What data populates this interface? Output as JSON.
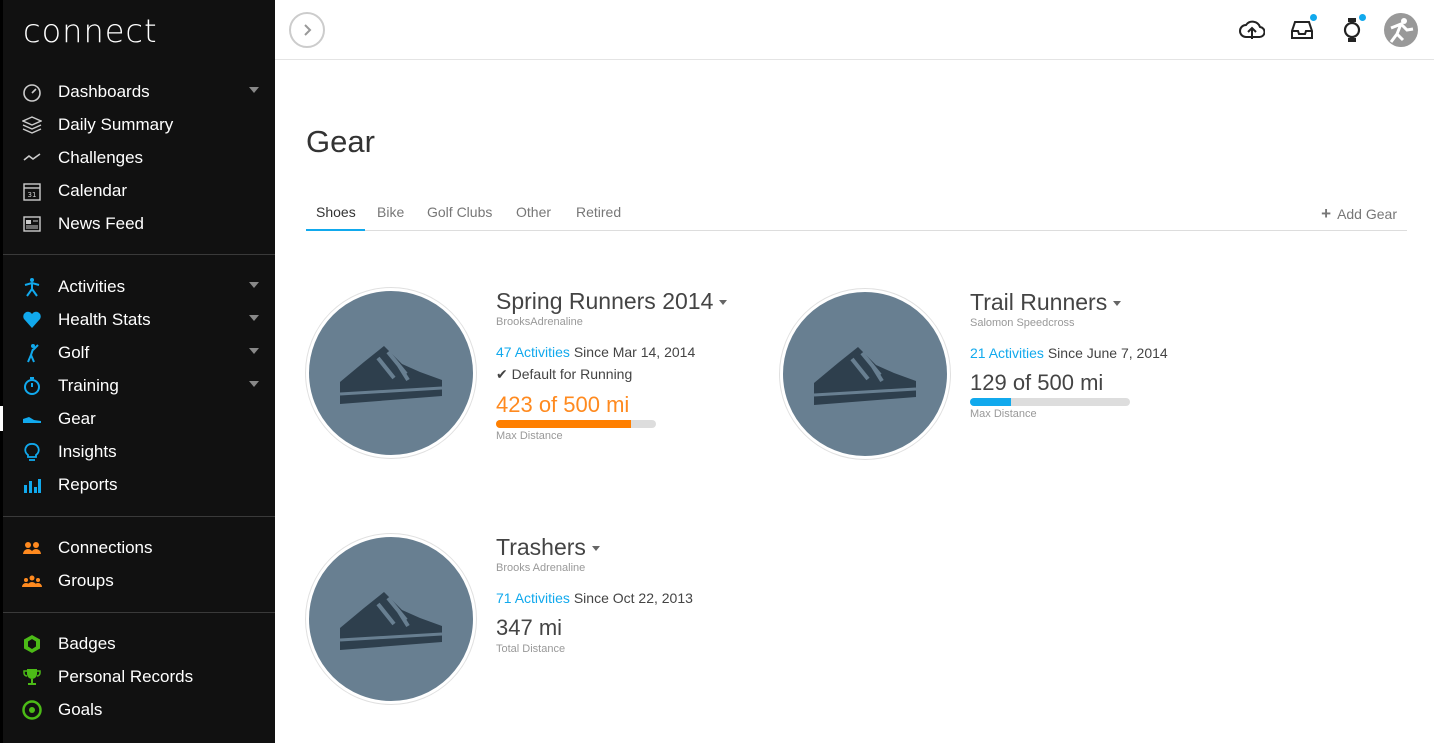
{
  "app": {
    "logo": "connect"
  },
  "sidebar": {
    "groups": [
      [
        {
          "label": "Dashboards",
          "icon": "dashboard-gauge-icon",
          "has_submenu": true
        },
        {
          "label": "Daily Summary",
          "icon": "layers-icon",
          "has_submenu": false
        },
        {
          "label": "Challenges",
          "icon": "trend-line-icon",
          "has_submenu": false
        },
        {
          "label": "Calendar",
          "icon": "calendar-icon",
          "has_submenu": false
        },
        {
          "label": "News Feed",
          "icon": "newspaper-icon",
          "has_submenu": false
        }
      ],
      [
        {
          "label": "Activities",
          "icon": "running-figure-icon",
          "has_submenu": true
        },
        {
          "label": "Health Stats",
          "icon": "heart-icon",
          "has_submenu": true
        },
        {
          "label": "Golf",
          "icon": "golfer-icon",
          "has_submenu": true
        },
        {
          "label": "Training",
          "icon": "stopwatch-icon",
          "has_submenu": true
        },
        {
          "label": "Gear",
          "icon": "shoe-icon",
          "has_submenu": false,
          "active": true
        },
        {
          "label": "Insights",
          "icon": "lightbulb-icon",
          "has_submenu": false
        },
        {
          "label": "Reports",
          "icon": "bar-chart-icon",
          "has_submenu": false
        }
      ],
      [
        {
          "label": "Connections",
          "icon": "people-pair-icon",
          "has_submenu": false
        },
        {
          "label": "Groups",
          "icon": "people-group-icon",
          "has_submenu": false
        }
      ],
      [
        {
          "label": "Badges",
          "icon": "hexagon-badge-icon",
          "has_submenu": false
        },
        {
          "label": "Personal Records",
          "icon": "trophy-icon",
          "has_submenu": false
        },
        {
          "label": "Goals",
          "icon": "target-icon",
          "has_submenu": false
        }
      ]
    ]
  },
  "topbar": {
    "icons": [
      "upload-cloud-icon",
      "inbox-icon",
      "watch-icon",
      "user-avatar-icon"
    ]
  },
  "main": {
    "title": "Gear",
    "tabs": [
      "Shoes",
      "Bike",
      "Golf Clubs",
      "Other",
      "Retired"
    ],
    "active_tab": "Shoes",
    "add_gear_label": "Add Gear"
  },
  "gear": [
    {
      "name": "Spring Runners 2014",
      "model": "BrooksAdrenaline",
      "activities_link": "47 Activities",
      "since": "Since Mar 14, 2014",
      "default_label": "Default for Running",
      "distance": "423 of 500 mi",
      "distance_color": "orange",
      "progress": 0.846,
      "bar_color": "#ff7f00",
      "sub_label": "Max Distance"
    },
    {
      "name": "Trail Runners",
      "model": "Salomon Speedcross",
      "activities_link": "21 Activities",
      "since": "Since June 7, 2014",
      "default_label": "",
      "distance": "129 of 500 mi",
      "distance_color": "default",
      "progress": 0.258,
      "bar_color": "#11a9ed",
      "sub_label": "Max Distance"
    },
    {
      "name": "Trashers",
      "model": "Brooks Adrenaline",
      "activities_link": "71 Activities",
      "since": "Since Oct 22, 2013",
      "default_label": "",
      "distance": "347 mi",
      "distance_color": "default",
      "progress": null,
      "bar_color": "",
      "sub_label": "Total Distance"
    }
  ]
}
